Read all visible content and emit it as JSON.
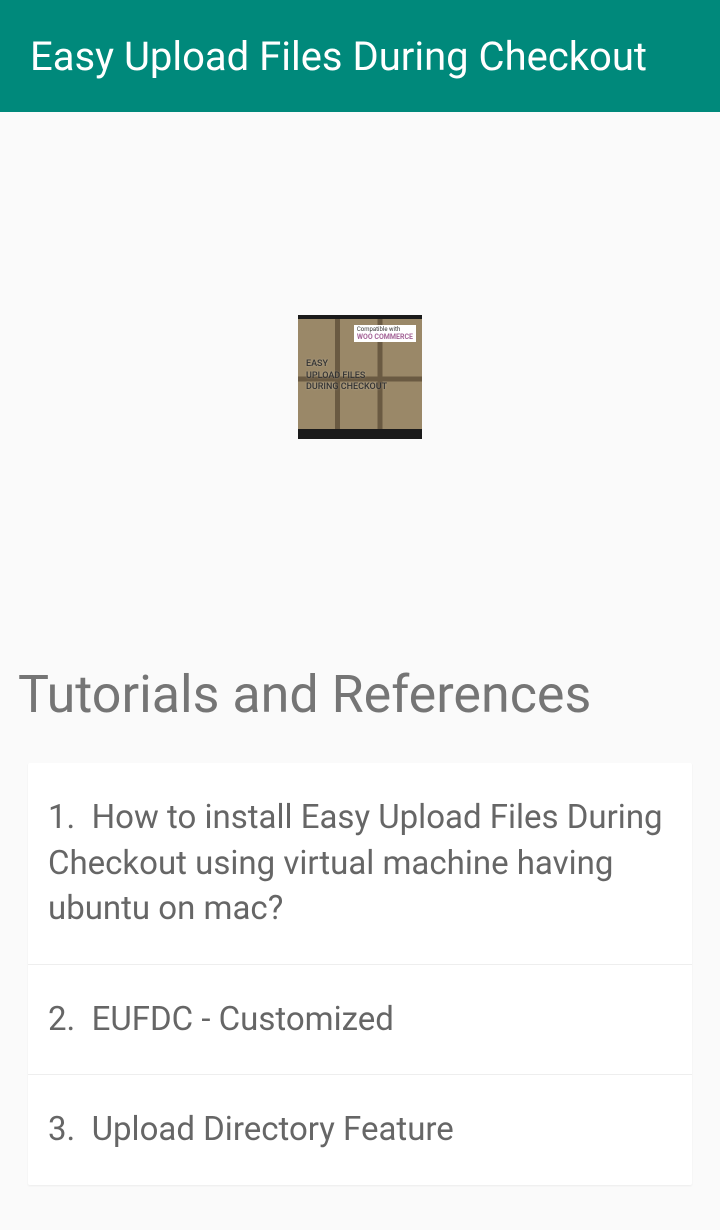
{
  "header": {
    "title": "Easy Upload Files During Checkout"
  },
  "productImage": {
    "compatibleLabel": "Compatible with",
    "wooLabel": "WOO COMMERCE",
    "line1": "EASY",
    "line2": "UPLOAD FILES",
    "line3": "DURING CHECKOUT"
  },
  "section": {
    "title": "Tutorials and References"
  },
  "tutorials": [
    {
      "number": "1.",
      "text": "How to install Easy Upload Files During Checkout using virtual machine having ubuntu on mac?"
    },
    {
      "number": "2.",
      "text": "EUFDC - Customized"
    },
    {
      "number": "3.",
      "text": "Upload Directory Feature"
    }
  ]
}
